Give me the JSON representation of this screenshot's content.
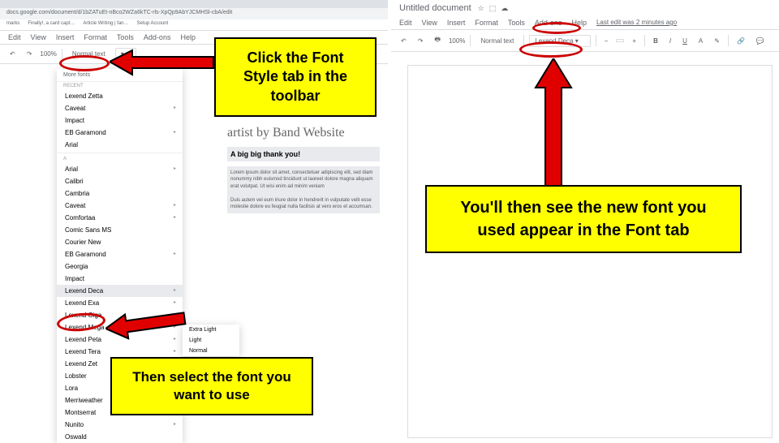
{
  "left": {
    "url": "docs.google.com/document/d/1bZATuEt-nBco2WZa6kTC-rls-XpQp9AbYJCMHSl-cbA/edit",
    "bookmarks": [
      "marks",
      "Finally!, a card capt…",
      "Article Writing | fan…",
      "Setup Account"
    ],
    "menubar": [
      "Edit",
      "View",
      "Insert",
      "Format",
      "Tools",
      "Add-ons",
      "Help"
    ],
    "last_edit": "Last edit was 2 minutes ago",
    "zoom": "100%",
    "styles_dd": "Normal text",
    "more_fonts": "More fonts",
    "recent_label": "RECENT",
    "recent_fonts": [
      "Lexend Zetta",
      "Caveat",
      "Impact",
      "EB Garamond",
      "Arial"
    ],
    "az_label": "A",
    "all_fonts": [
      "Arial",
      "Calibri",
      "Cambria",
      "Caveat",
      "Comfortaa",
      "Comic Sans MS",
      "Courier New",
      "EB Garamond",
      "Georgia",
      "Impact",
      "Lexend Deca",
      "Lexend Exa",
      "Lexend Giga",
      "Lexend Mega",
      "Lexend Peta",
      "Lexend Tera",
      "Lexend Zet",
      "Lobster",
      "Lora",
      "Merriweather",
      "Montserrat",
      "Nunito",
      "Oswald"
    ],
    "weights": [
      "Extra Light",
      "Light",
      "Normal"
    ],
    "doc_heading": "artist by Band Website",
    "doc_subhead": "A big big thank you!",
    "doc_para1": "Lorem ipsum dolor sit amet, consectetuer adipiscing elit, sed diam nonummy nibh euismod tincidunt ut laoreet dolore magna aliquam erat volutpat. Ut wisi enim ad minim veniam",
    "doc_para2": "Duis autem vel eum iriure dolor in hendrerit in vulputate velit esse molestie dolore eu feugiat nulla facilisis at vero eros et accumsan."
  },
  "right": {
    "doc_title": "Untitled document",
    "menubar": [
      "Edit",
      "View",
      "Insert",
      "Format",
      "Tools",
      "Add-ons",
      "Help"
    ],
    "last_edit": "Last edit was 2 minutes ago",
    "zoom": "100%",
    "styles_dd": "Normal text",
    "font_dd": "Lexend Deca",
    "font_size_minus": "−",
    "font_size_plus": "+",
    "bold": "B",
    "italic": "I",
    "underline": "U",
    "text_color": "A"
  },
  "callouts": {
    "c1": "Click the Font Style tab in the toolbar",
    "c2": "Then select the font you want to use",
    "c3": "You'll then see the new font you used appear in the Font tab"
  }
}
